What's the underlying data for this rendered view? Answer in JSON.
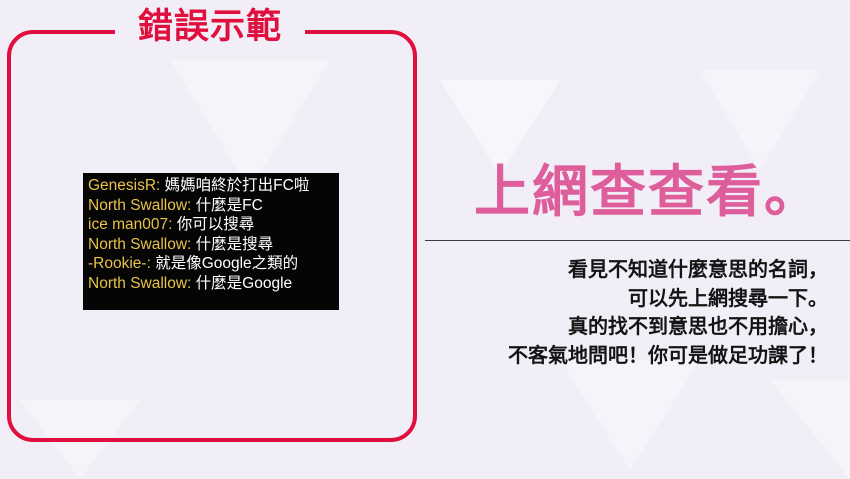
{
  "panel": {
    "title": "錯誤示範"
  },
  "chat": {
    "lines": [
      {
        "speaker": "GenesisR:",
        "message": " 媽媽咱終於打出FC啦"
      },
      {
        "speaker": "North Swallow:",
        "message": " 什麼是FC"
      },
      {
        "speaker": "ice man007:",
        "message": " 你可以搜尋"
      },
      {
        "speaker": "North Swallow:",
        "message": " 什麼是搜尋"
      },
      {
        "speaker": "-Rookie-:",
        "message": " 就是像Google之類的"
      },
      {
        "speaker": "North Swallow:",
        "message": " 什麼是Google"
      }
    ]
  },
  "headline": "上網查查看。",
  "body": {
    "lines": [
      "看見不知道什麼意思的名詞，",
      "可以先上網搜尋一下。",
      "真的找不到意思也不用擔心，",
      "不客氣地問吧！你可是做足功課了！"
    ]
  },
  "colors": {
    "accent_red": "#e0103e",
    "headline_pink": "#dd5e9a",
    "speaker_gold": "#e8c24a",
    "background": "#f2eef7"
  }
}
